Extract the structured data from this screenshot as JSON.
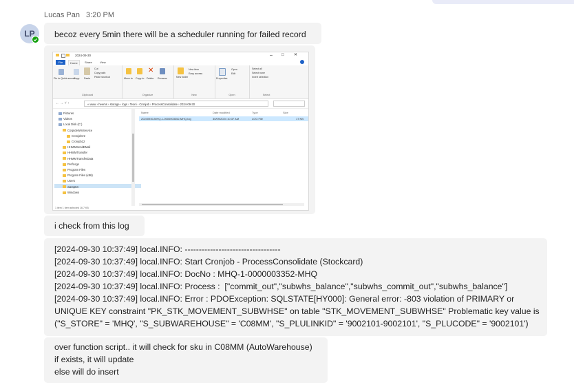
{
  "header": {
    "sender": "Lucas Pan",
    "time": "3:20 PM"
  },
  "avatar": {
    "initials": "LP",
    "status_color": "#13a10e"
  },
  "messages": {
    "m1": "becoz every 5min there will be a scheduler running for failed record",
    "m3": "i check from this log",
    "log_lines": [
      "[2024-09-30 10:37:49] local.INFO: ----------------------------------",
      "[2024-09-30 10:37:49] local.INFO: Start Cronjob - ProcessConsolidate (Stockcard)",
      "[2024-09-30 10:37:49] local.INFO: DocNo : MHQ-1-0000003352-MHQ",
      "[2024-09-30 10:37:49] local.INFO: Process :  [\"commit_out\",\"subwhs_balance\",\"subwhs_commit_out\",\"subwhs_balance\"]",
      "[2024-09-30 10:37:49] local.INFO: Error : PDOException: SQLSTATE[HY000]: General error: -803 violation of PRIMARY or",
      "UNIQUE KEY constraint \"PK_STK_MOVEMENT_SUBWHSE\" on table \"STK_MOVEMENT_SUBWHSE\" Problematic key value is",
      "(\"S_STORE\" = 'MHQ', \"S_SUBWAREHOUSE\" = 'C08MM', \"S_PLULINKID\" = '9002101-9002101', \"S_PLUCODE\" = '9002101')"
    ],
    "m5_lines": [
      "over function script.. it will check for sku in C08MM (AutoWarehouse)",
      "if exists, it will update",
      "else will do insert"
    ]
  },
  "screenshot": {
    "title": "2024-09-30",
    "win_min": "–",
    "win_max": "□",
    "win_close": "✕",
    "tabs": {
      "file": "File",
      "home": "Home",
      "share": "Share",
      "view": "View"
    },
    "ribbon": {
      "pin": "Pin to Quick access",
      "copy": "Copy",
      "paste": "Paste",
      "cut": "Cut",
      "copy_path": "Copy path",
      "paste_shortcut": "Paste shortcut",
      "clipboard": "Clipboard",
      "move_to": "Move to",
      "copy_to": "Copy to",
      "delete": "Delete",
      "rename": "Rename",
      "organize": "Organize",
      "new_folder": "New folder",
      "new_item": "New item",
      "easy_access": "Easy access",
      "new": "New",
      "properties": "Properties",
      "open": "Open",
      "edit": "Edit",
      "open_group": "Open",
      "select_all": "Select all",
      "select_none": "Select none",
      "invert_selection": "Invert selection",
      "select": "Select"
    },
    "address": "« www › heems › storage › logs › Teoni › Cronjob › ProcessConsolidate › 2024-09-30",
    "nav_items": [
      "Pictures",
      "Videos",
      "Local Disk (C:)",
      "CorpIdeWinService",
      "CronjobV2",
      "Cronjob12",
      "HHMMSendEMail",
      "HHWMTransfer",
      "HHMMTransferData",
      "PerfLogs",
      "Program Files",
      "Program Files (x86)",
      "Users",
      "wamp64",
      "Windows"
    ],
    "nav_selected": "wamp64",
    "columns": {
      "name": "Name",
      "date": "Date modified",
      "type": "Type",
      "size": "Size"
    },
    "file": {
      "name": "20240930-MHQ-1-0000003352-MHQ.log",
      "date": "30/09/2024 10:37 AM",
      "type": "LOG File",
      "size": "17 KB"
    },
    "status": "1 item     1 item selected  16.7 KB"
  }
}
